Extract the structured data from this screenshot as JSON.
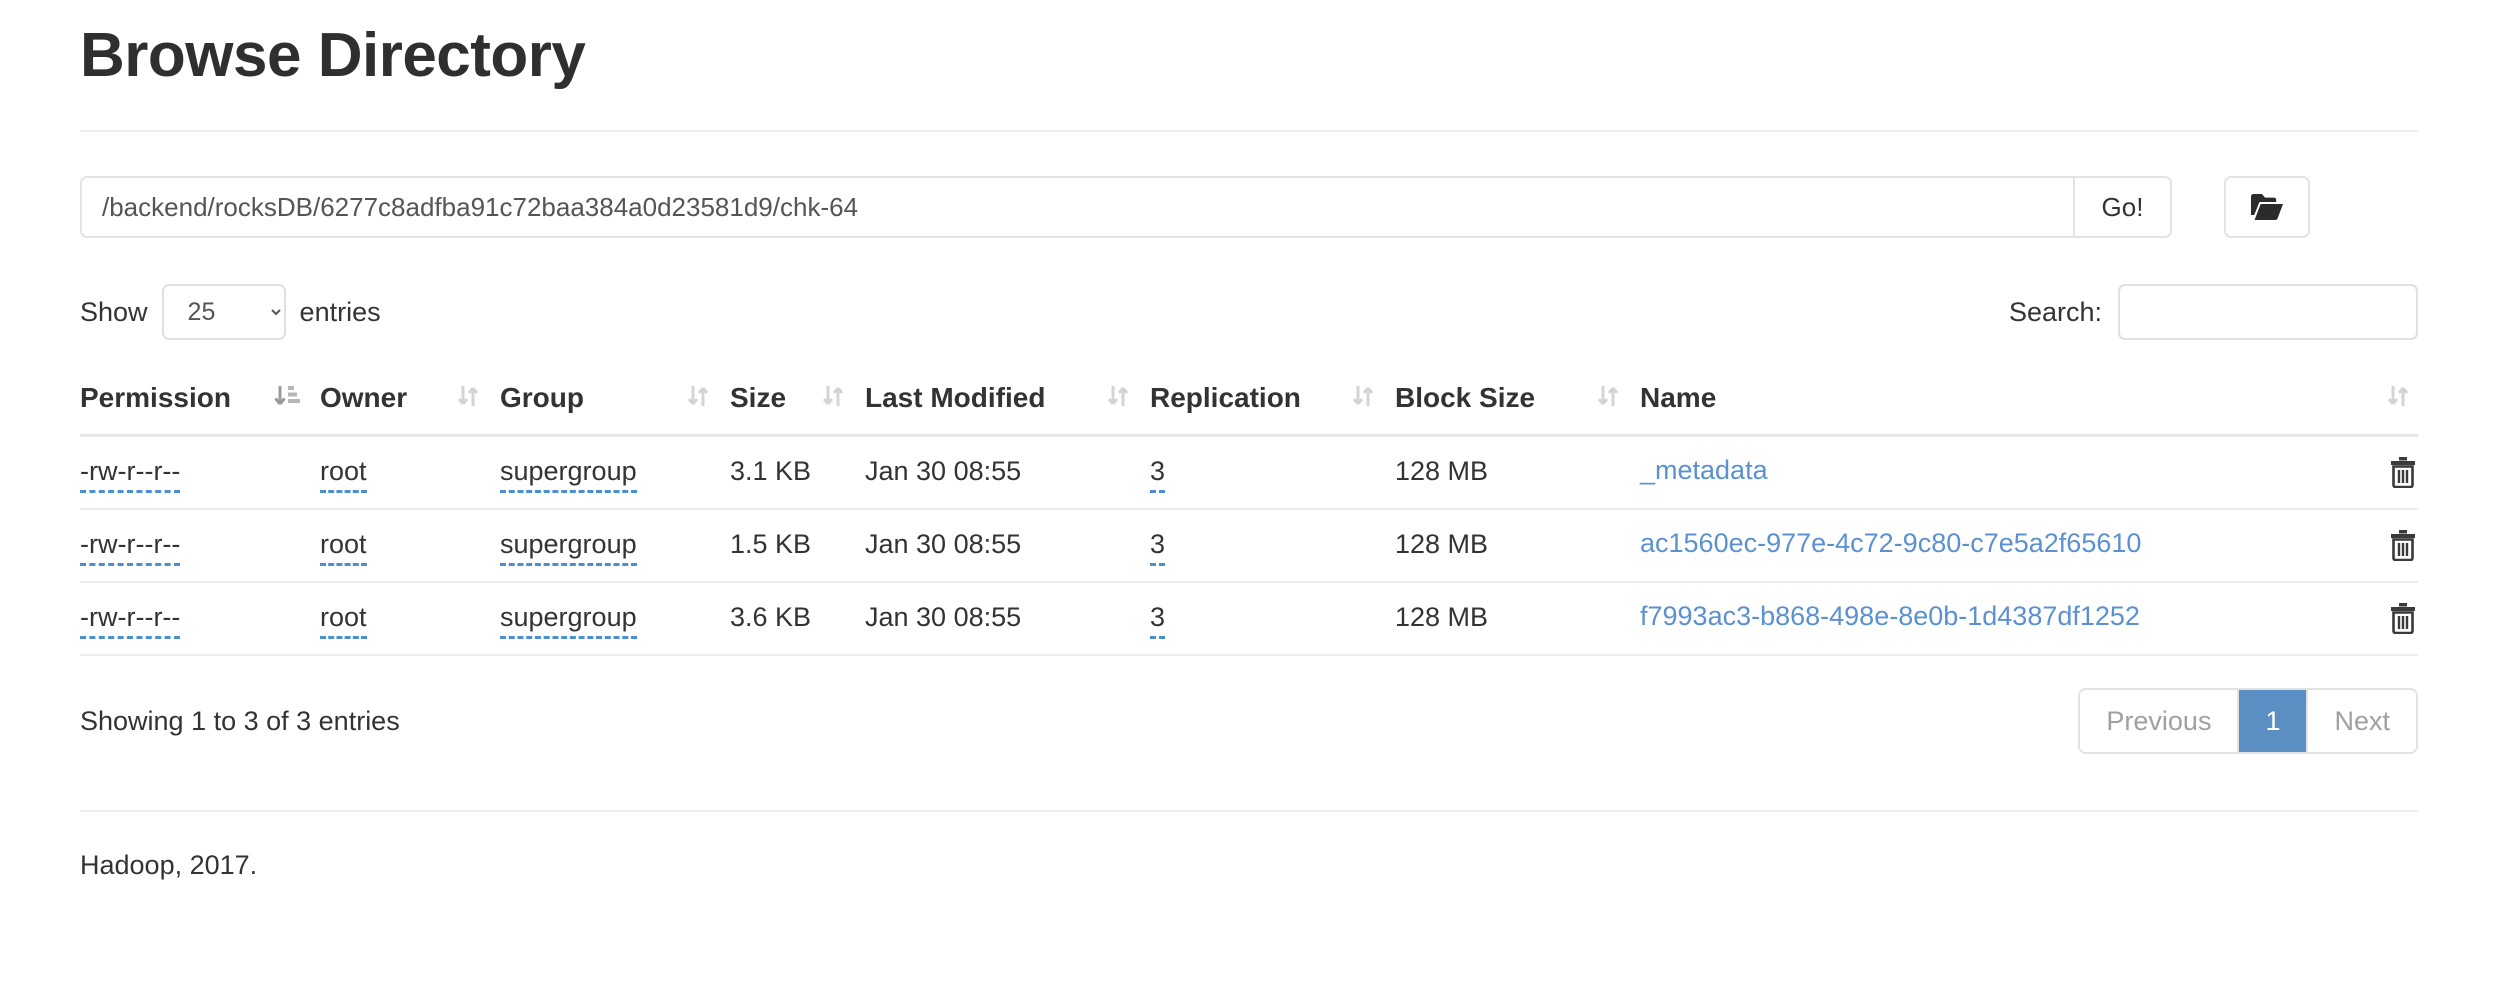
{
  "page": {
    "title": "Browse Directory",
    "footer_text": "Hadoop, 2017."
  },
  "path_bar": {
    "value": "/backend/rocksDB/6277c8adfba91c72baa384a0d23581d9/chk-64",
    "placeholder": "",
    "go_label": "Go!",
    "folder_icon": "open-folder-icon"
  },
  "controls": {
    "show_label": "Show",
    "entries_label": "entries",
    "page_length_selected": "25",
    "page_length_options": [
      "25"
    ],
    "search_label": "Search:",
    "search_value": "",
    "search_placeholder": ""
  },
  "table": {
    "columns": [
      {
        "label": "Permission",
        "sort_icon": "sort-amount-icon",
        "sorted": true
      },
      {
        "label": "Owner",
        "sort_icon": "sort-updown-icon",
        "sorted": false
      },
      {
        "label": "Group",
        "sort_icon": "sort-updown-icon",
        "sorted": false
      },
      {
        "label": "Size",
        "sort_icon": "sort-updown-icon",
        "sorted": false
      },
      {
        "label": "Last Modified",
        "sort_icon": "sort-updown-icon",
        "sorted": false
      },
      {
        "label": "Replication",
        "sort_icon": "sort-updown-icon",
        "sorted": false
      },
      {
        "label": "Block Size",
        "sort_icon": "sort-updown-icon",
        "sorted": false
      },
      {
        "label": "Name",
        "sort_icon": "sort-updown-icon",
        "sorted": false
      }
    ],
    "rows": [
      {
        "permission": "-rw-r--r--",
        "owner": "root",
        "group": "supergroup",
        "size": "3.1 KB",
        "last_modified": "Jan 30 08:55",
        "replication": "3",
        "block_size": "128 MB",
        "name": "_metadata",
        "delete_icon": "trash-icon"
      },
      {
        "permission": "-rw-r--r--",
        "owner": "root",
        "group": "supergroup",
        "size": "1.5 KB",
        "last_modified": "Jan 30 08:55",
        "replication": "3",
        "block_size": "128 MB",
        "name": "ac1560ec-977e-4c72-9c80-c7e5a2f65610",
        "delete_icon": "trash-icon"
      },
      {
        "permission": "-rw-r--r--",
        "owner": "root",
        "group": "supergroup",
        "size": "3.6 KB",
        "last_modified": "Jan 30 08:55",
        "replication": "3",
        "block_size": "128 MB",
        "name": "f7993ac3-b868-498e-8e0b-1d4387df1252",
        "delete_icon": "trash-icon"
      }
    ]
  },
  "pagination": {
    "info": "Showing 1 to 3 of 3 entries",
    "previous_label": "Previous",
    "next_label": "Next",
    "pages": [
      "1"
    ],
    "current_page": "1"
  },
  "colors": {
    "link_blue": "#5b91d1",
    "active_page_blue": "#5b8fc4",
    "dashed_underline": "#4b8fd1",
    "border_grey": "#e3e3e3",
    "text_dark": "#333333"
  }
}
